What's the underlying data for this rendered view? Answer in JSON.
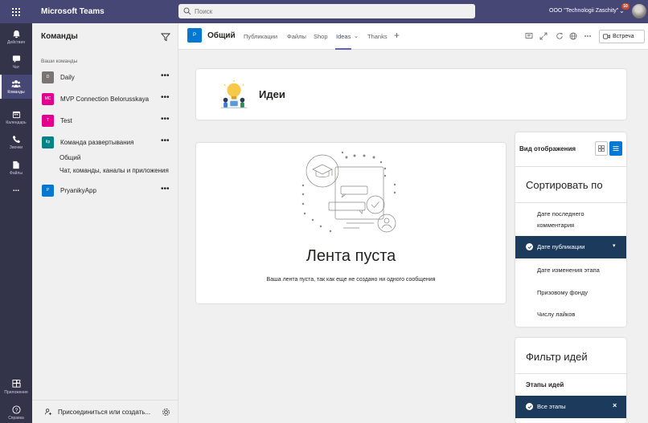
{
  "app": {
    "title": "Microsoft Teams",
    "search_placeholder": "Поиск",
    "org_name": "OOO \"Technologii Zaschity\"",
    "notification_count": "10"
  },
  "rail": {
    "items": [
      {
        "label": "Действия",
        "icon": "bell-icon"
      },
      {
        "label": "Чат",
        "icon": "chat-icon"
      },
      {
        "label": "Команды",
        "icon": "teams-icon"
      },
      {
        "label": "Календарь",
        "icon": "calendar-icon"
      },
      {
        "label": "Звонки",
        "icon": "phone-icon"
      },
      {
        "label": "Файлы",
        "icon": "file-icon"
      },
      {
        "label": "...",
        "icon": "more-icon"
      }
    ],
    "bottom": [
      {
        "label": "Приложения",
        "icon": "apps-icon"
      },
      {
        "label": "Справка",
        "icon": "help-icon"
      }
    ]
  },
  "teams_panel": {
    "title": "Команды",
    "section_label": "Ваши команды",
    "teams": [
      {
        "initials": "D",
        "name": "Daily",
        "color": "#7a7574"
      },
      {
        "initials": "MC",
        "name": "MVP Connection Belorusskaya",
        "color": "#e3008c"
      },
      {
        "initials": "T",
        "name": "Test",
        "color": "#e3008c"
      },
      {
        "initials": "Кр",
        "name": "Команда развертывания",
        "color": "#038387"
      },
      {
        "initials": "P",
        "name": "PryanikyApp",
        "color": "#0078d4"
      }
    ],
    "channels": [
      "Общий",
      "Чат, команды, каналы и приложения"
    ],
    "more_label": "•••",
    "footer_label": "Присоединиться или создать..."
  },
  "channel_header": {
    "avatar": "P",
    "name": "Общий",
    "tabs": [
      "Публикации",
      "Файлы",
      "Shop",
      "Ideas",
      "Thanks"
    ],
    "meet_label": "Встреча"
  },
  "ideas": {
    "title": "Идеи",
    "empty_title": "Лента пуста",
    "empty_subtitle": "Ваша лента пуста, так как еще не создано ни одного сообщения"
  },
  "sidebar": {
    "view_label": "Вид отображения",
    "sort_title": "Сортировать по",
    "sort_options": [
      "Дате последнего комментария",
      "Дате публикации",
      "Дате изменения этапа",
      "Призовому фонду",
      "Числу лайков"
    ],
    "sort_selected": "Дате публикации",
    "filter_title": "Фильтр идей",
    "filter_subtitle": "Этапы идей",
    "filter_selected": "Все этапы"
  },
  "colors": {
    "titlebar": "#464775",
    "rail": "#33344a",
    "accent": "#6264a7",
    "selected": "#1b3a5c",
    "primary": "#0078d4"
  }
}
